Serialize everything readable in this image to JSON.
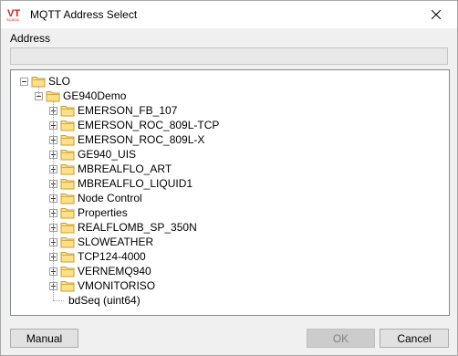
{
  "window": {
    "title": "MQTT Address Select",
    "logo_text": "VT",
    "logo_sub": "SCADA"
  },
  "address": {
    "label": "Address",
    "value": ""
  },
  "tree": {
    "root": {
      "label": "SLO",
      "expanded": true
    },
    "child": {
      "label": "GE940Demo",
      "expanded": true
    },
    "items": [
      {
        "label": "EMERSON_FB_107",
        "expandable": true
      },
      {
        "label": "EMERSON_ROC_809L-TCP",
        "expandable": true
      },
      {
        "label": "EMERSON_ROC_809L-X",
        "expandable": true
      },
      {
        "label": "GE940_UIS",
        "expandable": true
      },
      {
        "label": "MBREALFLO_ART",
        "expandable": true
      },
      {
        "label": "MBREALFLO_LIQUID1",
        "expandable": true
      },
      {
        "label": "Node Control",
        "expandable": true
      },
      {
        "label": "Properties",
        "expandable": true
      },
      {
        "label": "REALFLOMB_SP_350N",
        "expandable": true
      },
      {
        "label": "SLOWEATHER",
        "expandable": true
      },
      {
        "label": "TCP124-4000",
        "expandable": true
      },
      {
        "label": "VERNEMQ940",
        "expandable": true
      },
      {
        "label": "VMONITORISO",
        "expandable": true
      }
    ],
    "leaf": {
      "label": "bdSeq (uint64)"
    }
  },
  "buttons": {
    "manual": "Manual",
    "ok": "OK",
    "cancel": "Cancel"
  },
  "colors": {
    "folder_fill": "#ffe08a",
    "folder_stroke": "#c8a02a",
    "logo_red": "#cc1f1f",
    "focus_blue": "#0078d7"
  }
}
